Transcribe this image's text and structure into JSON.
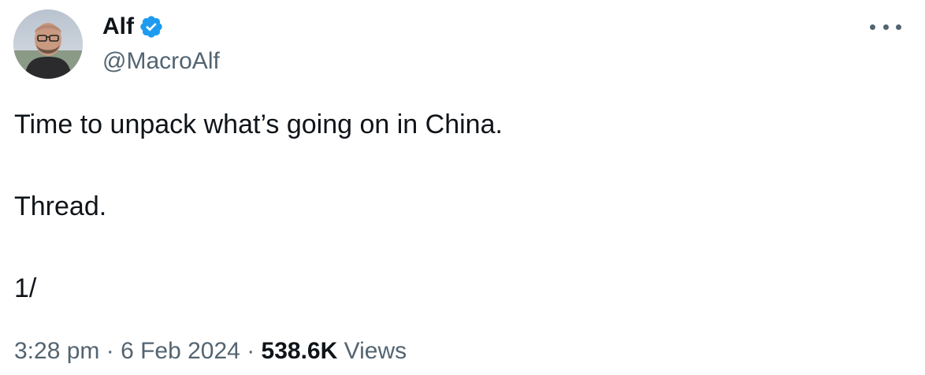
{
  "author": {
    "display_name": "Alf",
    "handle": "@MacroAlf",
    "verified": true,
    "verified_color": "#1d9bf0"
  },
  "icons": {
    "avatar": "profile-photo",
    "verified": "verified-badge-icon",
    "more": "more-options-icon"
  },
  "tweet": {
    "lines": [
      "Time to unpack what’s going on in China.",
      "Thread.",
      "1/"
    ]
  },
  "meta": {
    "time": "3:28 pm",
    "separator": " · ",
    "date": "6 Feb 2024",
    "views_count": "538.6K",
    "views_label": "Views"
  }
}
